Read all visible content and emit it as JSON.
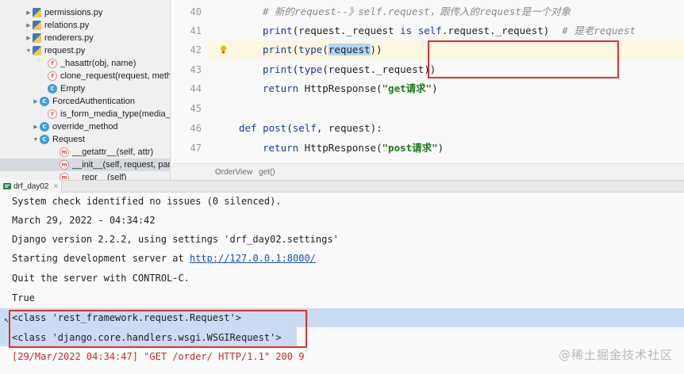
{
  "tree": {
    "items": [
      {
        "label": "permissions.py",
        "icon": "python-file-icon",
        "badge": "",
        "arrow": "▶"
      },
      {
        "label": "relations.py",
        "icon": "python-file-icon",
        "badge": "",
        "arrow": "▶"
      },
      {
        "label": "renderers.py",
        "icon": "python-file-icon",
        "badge": "",
        "arrow": "▶"
      },
      {
        "label": "request.py",
        "icon": "python-file-icon",
        "badge": "",
        "arrow": "▼"
      },
      {
        "label": "_hasattr(obj, name)",
        "icon": "function-icon",
        "badge": "f",
        "arrow": ""
      },
      {
        "label": "clone_request(request, meth",
        "icon": "function-icon",
        "badge": "f",
        "arrow": ""
      },
      {
        "label": "Empty",
        "icon": "class-icon",
        "badge": "C",
        "arrow": ""
      },
      {
        "label": "ForcedAuthentication",
        "icon": "class-icon",
        "badge": "C",
        "arrow": "▶"
      },
      {
        "label": "is_form_media_type(media_t",
        "icon": "function-icon",
        "badge": "f",
        "arrow": ""
      },
      {
        "label": "override_method",
        "icon": "class-icon",
        "badge": "C",
        "arrow": "▶"
      },
      {
        "label": "Request",
        "icon": "class-icon",
        "badge": "C",
        "arrow": "▼"
      },
      {
        "label": "__getattr__(self, attr)",
        "icon": "method-icon",
        "badge": "m",
        "arrow": ""
      },
      {
        "label": "__init__(self, request, pars",
        "icon": "method-icon",
        "badge": "m",
        "arrow": ""
      },
      {
        "label": "__repr__(self)",
        "icon": "method-icon",
        "badge": "m",
        "arrow": ""
      }
    ]
  },
  "editor": {
    "line_numbers": [
      "40",
      "41",
      "42",
      "43",
      "44",
      "45",
      "46",
      "47"
    ],
    "line40": {
      "comment": "# 新的request--》self.request，跟传入的request是一个对象"
    },
    "line41": {
      "a": "print",
      "b": "(request._request ",
      "c": "is",
      "d": " ",
      "e": "self",
      "f": ".request._request)",
      "g": "# 是老request"
    },
    "line42": {
      "a": "print",
      "b": "(",
      "c": "type",
      "d": "(",
      "e": "request",
      "f": "))"
    },
    "line43": {
      "a": "print",
      "b": "(",
      "c": "type",
      "d": "(request._request))"
    },
    "line44": {
      "a": "return",
      "b": " HttpResponse(",
      "c": "\"get请求\"",
      "d": ")"
    },
    "line46": {
      "a": "def",
      "b": " ",
      "c": "post",
      "d": "(",
      "e": "self",
      "f": ", request):"
    },
    "line47": {
      "a": "return",
      "b": " HttpResponse(",
      "c": "\"post请求\"",
      "d": ")"
    },
    "breadcrumb": [
      "OrderView",
      "get()"
    ]
  },
  "run": {
    "tab_label": "drf_day02",
    "tab_close": "×",
    "lines": [
      {
        "text": "System check identified no issues (0 silenced)."
      },
      {
        "text": "March 29, 2022 - 04:34:42"
      },
      {
        "text": "Django version 2.2.2, using settings 'drf_day02.settings'"
      },
      {
        "text": "Starting development server at "
      },
      {
        "text": "Quit the server with CONTROL-C."
      },
      {
        "text": "True"
      },
      {
        "text": "<class 'rest_framework.request.Request'>"
      },
      {
        "text": "<class 'django.core.handlers.wsgi.WSGIRequest'>"
      },
      {
        "text": "[29/Mar/2022 04:34:47] \"GET /order/ HTTP/1.1\" 200 9"
      }
    ],
    "server_link": "http://127.0.0.1:8000/",
    "cursor": "↖"
  },
  "watermark": "@稀土掘金技术社区",
  "colors": {
    "annotation_red": "#e03131",
    "selection_blue": "#c9dcf4",
    "keyword_blue": "#1c36a8",
    "string_green": "#1b7a1b"
  }
}
